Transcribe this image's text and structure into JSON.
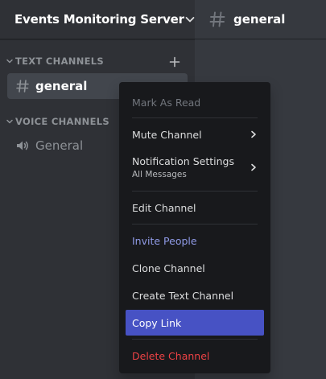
{
  "server": {
    "name": "Events Monitoring Server",
    "header_icon": "chevron-down-icon"
  },
  "main_header": {
    "icon": "hashtag-icon",
    "channel_name": "general"
  },
  "sidebar": {
    "categories": [
      {
        "label": "TEXT CHANNELS",
        "icon": "caret-down-icon"
      },
      {
        "label": "VOICE CHANNELS",
        "icon": "caret-down-icon"
      }
    ],
    "add_icon": "plus-icon",
    "text_channels": [
      {
        "name": "general",
        "icon": "hashtag-icon",
        "active": true
      }
    ],
    "voice_channels": [
      {
        "name": "General",
        "icon": "speaker-icon"
      }
    ]
  },
  "context_menu": {
    "items": [
      {
        "label": "Mark As Read",
        "state": "disabled"
      },
      {
        "label": "Mute Channel",
        "has_submenu": true
      },
      {
        "label": "Notification Settings",
        "sublabel": "All Messages",
        "has_submenu": true
      },
      {
        "label": "Edit Channel"
      },
      {
        "label": "Invite People",
        "style": "brand"
      },
      {
        "label": "Clone Channel"
      },
      {
        "label": "Create Text Channel"
      },
      {
        "label": "Copy Link",
        "state": "selected"
      },
      {
        "label": "Delete Channel",
        "style": "danger"
      }
    ]
  },
  "colors": {
    "sidebar_bg": "#2f3136",
    "main_bg": "#36393f",
    "menu_bg": "#18191c",
    "selected_bg": "#4752c4",
    "brand_text": "#8f9ae6",
    "danger_text": "#ed4245",
    "muted_text": "#8e9297"
  }
}
